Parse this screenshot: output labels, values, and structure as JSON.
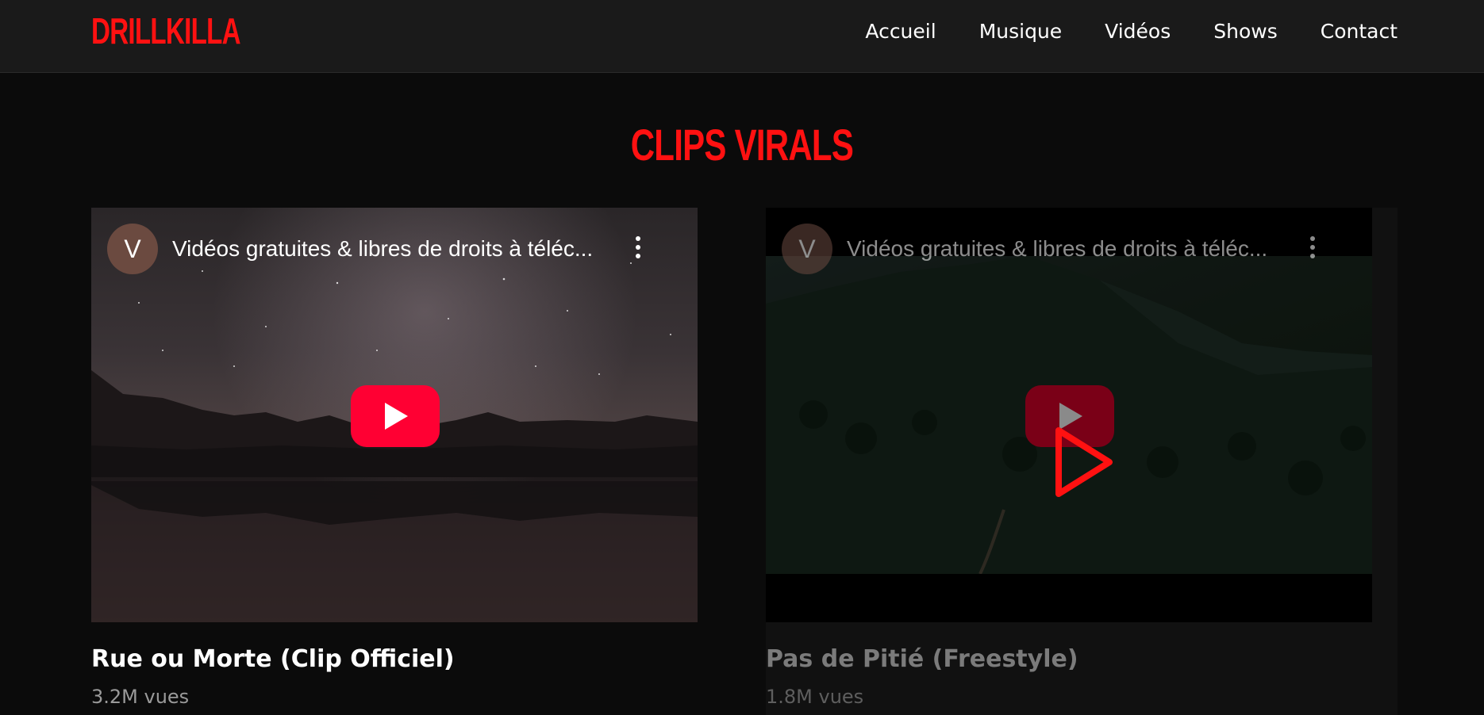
{
  "brand": {
    "logo": "DRILLKILLA",
    "accent_color": "#ff1111"
  },
  "nav": {
    "items": [
      "Accueil",
      "Musique",
      "Vidéos",
      "Shows",
      "Contact"
    ]
  },
  "section": {
    "title": "CLIPS VIRALS"
  },
  "videos": [
    {
      "channel_initial": "V",
      "embed_title": "Vidéos gratuites & libres de droits à téléc...",
      "title": "Rue ou Morte (Clip Officiel)",
      "views": "3.2M vues",
      "thumbnail": "night-sky-mountains-lake"
    },
    {
      "channel_initial": "V",
      "embed_title": "Vidéos gratuites & libres de droits à téléc...",
      "title": "Pas de Pitié (Freestyle)",
      "views": "1.8M vues",
      "thumbnail": "forest-aerial"
    }
  ],
  "icons": {
    "play": "youtube-play-icon",
    "menu": "more-vert-icon",
    "overlay": "play-outline-icon"
  }
}
